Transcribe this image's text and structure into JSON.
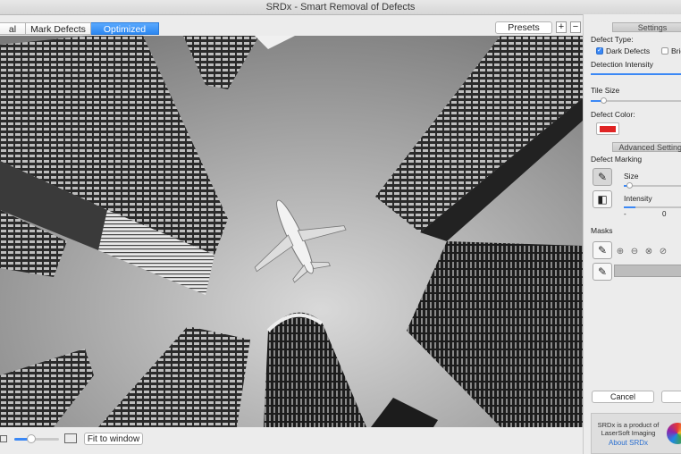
{
  "window": {
    "title": "SRDx - Smart Removal of Defects"
  },
  "tabs": [
    {
      "label": "al",
      "active": false
    },
    {
      "label": "Mark Defects",
      "active": false
    },
    {
      "label": "Optimized",
      "active": true
    }
  ],
  "toolbar": {
    "presets_label": "Presets",
    "add_label": "+",
    "remove_label": "−"
  },
  "bottom_bar": {
    "fit_label": "Fit to window",
    "zoom_level": 0.35
  },
  "settings": {
    "header": "Settings",
    "defect_type_label": "Defect Type:",
    "dark_defects_label": "Dark Defects",
    "dark_defects_checked": true,
    "bright_defects_label": "Brig",
    "bright_defects_checked": false,
    "detection_intensity_label": "Detection Intensity",
    "detection_intensity": 1.0,
    "tile_size_label": "Tile Size",
    "tile_size": 0.15,
    "defect_color_label": "Defect Color:",
    "defect_color": "#e02424"
  },
  "advanced": {
    "header": "Advanced Settings",
    "defect_marking_label": "Defect Marking",
    "size_label": "Size",
    "size": 0.1,
    "intensity_label": "Intensity",
    "intensity": 0.2,
    "intensity_min_label": "-",
    "intensity_value": "0",
    "masks_label": "Masks"
  },
  "icons": {
    "marker_tool": "pencil-icon",
    "eraser_tool": "eraser-icon",
    "mask_pen": "pen-icon"
  },
  "actions": {
    "cancel_label": "Cancel"
  },
  "about": {
    "line1": "SRDx is a product of",
    "line2": "LaserSoft Imaging",
    "link": "About SRDx"
  },
  "colors": {
    "accent": "#3b88f5",
    "tab_active": "#2c87f0",
    "defect": "#e02424"
  }
}
